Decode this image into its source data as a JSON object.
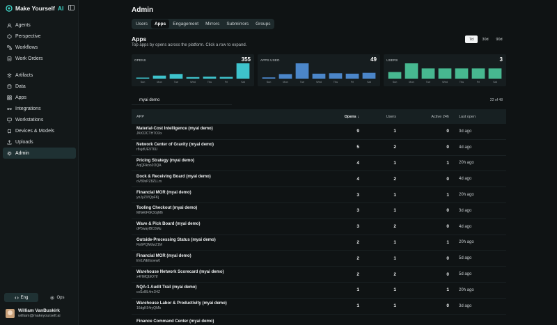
{
  "brand": {
    "name": "Make Yourself",
    "accent": "AI"
  },
  "nav": [
    {
      "label": "Agents",
      "icon": "agents-icon"
    },
    {
      "label": "Perspective",
      "icon": "perspective-icon"
    },
    {
      "label": "Workflows",
      "icon": "workflows-icon"
    },
    {
      "label": "Work Orders",
      "icon": "work-orders-icon"
    },
    {
      "label": "Artifacts",
      "icon": "artifacts-icon"
    },
    {
      "label": "Data",
      "icon": "data-icon"
    },
    {
      "label": "Apps",
      "icon": "apps-icon"
    },
    {
      "label": "Integrations",
      "icon": "integrations-icon"
    },
    {
      "label": "Workstations",
      "icon": "workstations-icon"
    },
    {
      "label": "Devices & Models",
      "icon": "devices-icon"
    },
    {
      "label": "Uploads",
      "icon": "uploads-icon"
    },
    {
      "label": "Admin",
      "icon": "admin-icon",
      "active": true
    }
  ],
  "modes": {
    "eng": "Eng",
    "ops": "Ops",
    "active": "Eng"
  },
  "user": {
    "name": "William VanBuskirk",
    "email": "william@makeyourself.ai"
  },
  "page": {
    "title": "Admin"
  },
  "tabs": [
    "Users",
    "Apps",
    "Engagement",
    "Mirrors",
    "Submirrors",
    "Groups"
  ],
  "active_tab": "Apps",
  "section": {
    "title": "Apps",
    "subtitle": "Top apps by opens across the platform. Click a row to expand."
  },
  "ranges": [
    "7d",
    "30d",
    "90d"
  ],
  "active_range": "7d",
  "colors": {
    "accent": "#3fd1c4",
    "opens": "#3ec3cc",
    "apps_used": "#4b86c9",
    "users": "#47b890"
  },
  "cards": [
    {
      "label": "OPENS",
      "value": "355",
      "color": "#3ec3cc",
      "days": [
        "Sun",
        "Mon",
        "Tue",
        "Wed",
        "Thu",
        "Fri",
        "Sat"
      ],
      "values": [
        18,
        70,
        108,
        36,
        46,
        40,
        355
      ]
    },
    {
      "label": "APPS USED",
      "value": "49",
      "color": "#4b86c9",
      "days": [
        "Sun",
        "Mon",
        "Tue",
        "Wed",
        "Thu",
        "Fri",
        "Sat"
      ],
      "values": [
        3,
        11,
        37,
        12,
        13,
        12,
        14
      ]
    },
    {
      "label": "USERS",
      "value": "3",
      "color": "#47b890",
      "days": [
        "Sun",
        "Mon",
        "Tue",
        "Wed",
        "Thu",
        "Fri",
        "Sat"
      ],
      "values": [
        1.3,
        3,
        2,
        2,
        2,
        2,
        2
      ]
    }
  ],
  "filter": {
    "value": "myai demo",
    "count": "22 of 48"
  },
  "table": {
    "headers": {
      "app": "APP",
      "opens": "Opens ↓",
      "users": "Users",
      "active": "Active 24h",
      "last": "Last open"
    },
    "rows": [
      {
        "name": "Material-Cost Intelligence (myai demo)",
        "id": "JKtO2CTH7OXx",
        "opens": "9",
        "users": "1",
        "active": "0",
        "last": "3d ago"
      },
      {
        "name": "Network Center of Gravity (myai demo)",
        "id": "r8ujdUE9T6U",
        "opens": "5",
        "users": "2",
        "active": "0",
        "last": "4d ago"
      },
      {
        "name": "Pricing Strategy (myai demo)",
        "id": "AqQRkoo2OQA",
        "opens": "4",
        "users": "1",
        "active": "1",
        "last": "20h ago"
      },
      {
        "name": "Dock & Receiving Board (myai demo)",
        "id": "oV89sPZ8ZLLm",
        "opens": "4",
        "users": "2",
        "active": "0",
        "last": "4d ago"
      },
      {
        "name": "Financial MOR (myai demo)",
        "id": "yoJyZIVQpFKj",
        "opens": "3",
        "users": "1",
        "active": "1",
        "last": "20h ago"
      },
      {
        "name": "Tooling Checkout (myai demo)",
        "id": "MNA6F6K3GjM6",
        "opens": "3",
        "users": "1",
        "active": "0",
        "last": "3d ago"
      },
      {
        "name": "Wave & Pick Board (myai demo)",
        "id": "dP5waylBC6Mu",
        "opens": "3",
        "users": "2",
        "active": "0",
        "last": "4d ago"
      },
      {
        "name": "Outside-Processing Status (myai demo)",
        "id": "Ro6PQMdwZ1M",
        "opens": "2",
        "users": "1",
        "active": "1",
        "last": "20h ago"
      },
      {
        "name": "Financial MOR (myai demo)",
        "id": "EVLWElIsoew0",
        "opens": "2",
        "users": "1",
        "active": "0",
        "last": "5d ago"
      },
      {
        "name": "Warehouse Network Scorecard (myai demo)",
        "id": "x4HMQbIO7tf",
        "opens": "2",
        "users": "2",
        "active": "0",
        "last": "5d ago"
      },
      {
        "name": "NQA-1 Audit Trail (myai demo)",
        "id": "cxSzl8L4m1HZ",
        "opens": "1",
        "users": "1",
        "active": "1",
        "last": "20h ago"
      },
      {
        "name": "Warehouse Labor & Productivity (myai demo)",
        "id": "16dgK54ryQMb",
        "opens": "1",
        "users": "1",
        "active": "0",
        "last": "3d ago"
      },
      {
        "name": "Finance Command Center (myai demo)",
        "id": "",
        "opens": "",
        "users": "",
        "active": "",
        "last": ""
      }
    ]
  }
}
